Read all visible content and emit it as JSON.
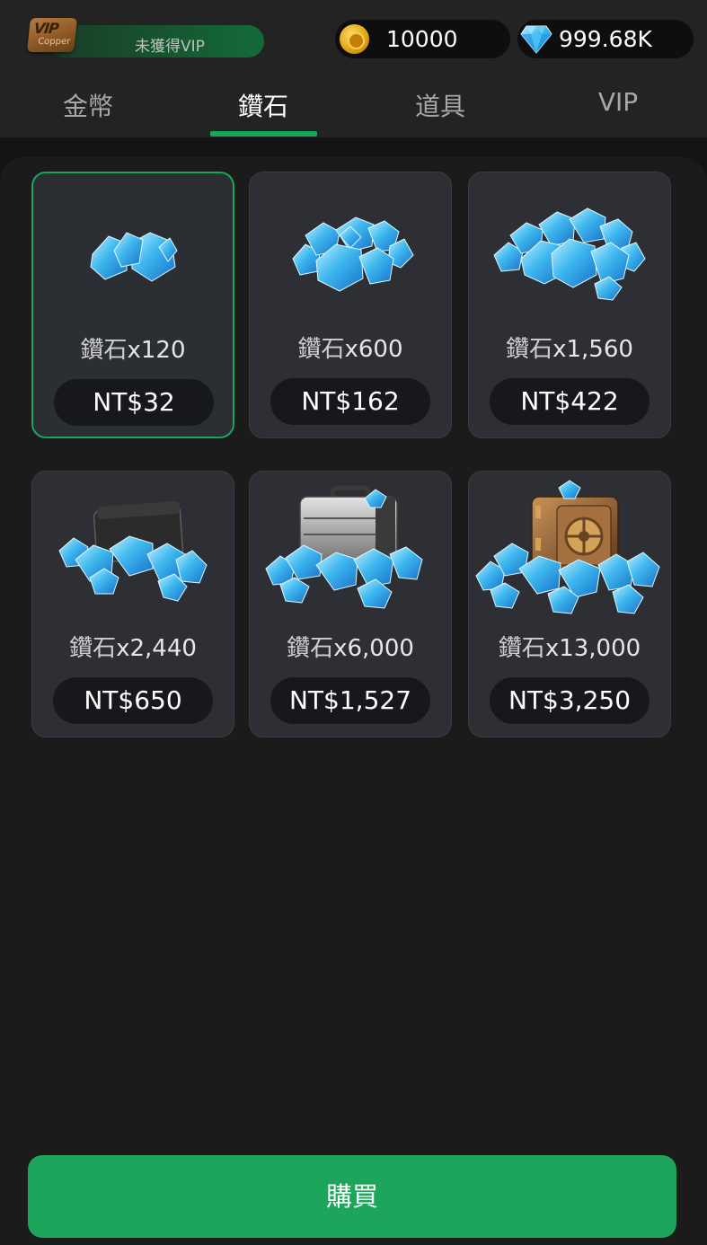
{
  "header": {
    "vip_badge": {
      "main": "VIP",
      "sub": "Copper"
    },
    "vip_status": "未獲得VIP",
    "coins": {
      "icon": "gold-coin-icon",
      "value": "10000"
    },
    "gems": {
      "icon": "diamond-icon",
      "value": "999.68K"
    }
  },
  "tabs": [
    {
      "label": "金幣",
      "active": false
    },
    {
      "label": "鑽石",
      "active": true
    },
    {
      "label": "道具",
      "active": false
    },
    {
      "label": "VIP",
      "active": false
    }
  ],
  "products": [
    {
      "name": "鑽石",
      "qty": "x120",
      "price": "NT$32",
      "art": "small-gem-pile",
      "selected": true
    },
    {
      "name": "鑽石",
      "qty": "x600",
      "price": "NT$162",
      "art": "medium-gem-pile",
      "selected": false
    },
    {
      "name": "鑽石",
      "qty": "x1,560",
      "price": "NT$422",
      "art": "large-gem-pile",
      "selected": false
    },
    {
      "name": "鑽石",
      "qty": "x2,440",
      "price": "NT$650",
      "art": "wallet-gem-pile",
      "selected": false
    },
    {
      "name": "鑽石",
      "qty": "x6,000",
      "price": "NT$1,527",
      "art": "briefcase-gem-pile",
      "selected": false
    },
    {
      "name": "鑽石",
      "qty": "x13,000",
      "price": "NT$3,250",
      "art": "safe-gem-pile",
      "selected": false
    }
  ],
  "buy_button": "購買",
  "colors": {
    "accent": "#1ea55c",
    "background": "#1b1b1b",
    "card": "#2d2f35",
    "gem": "#3fb8ef"
  }
}
